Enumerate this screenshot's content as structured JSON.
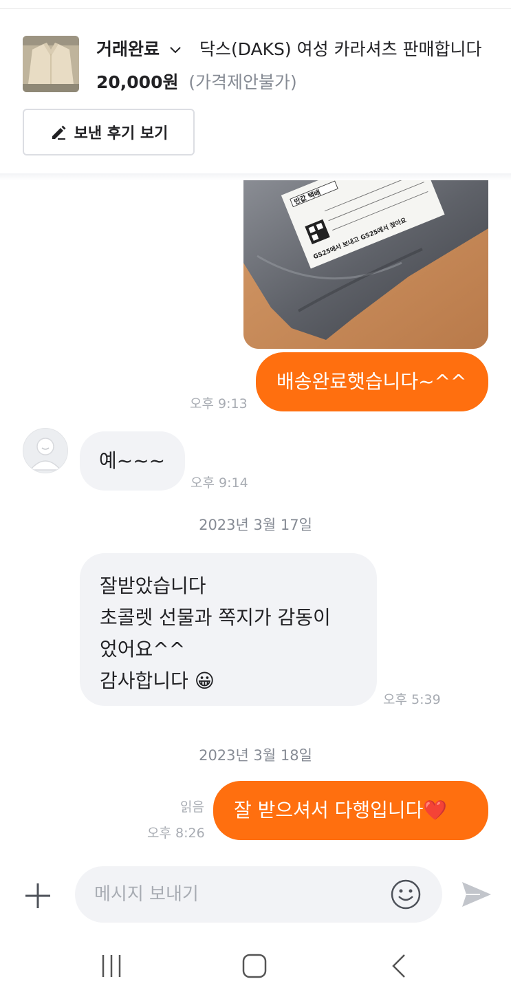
{
  "product": {
    "status": "거래완료",
    "title": "닥스(DAKS) 여성 카라셔츠 판매합니다",
    "price": "20,000원",
    "price_note": "(가격제안불가)"
  },
  "review_button": {
    "label": "보낸 후기 보기"
  },
  "messages": [
    {
      "from": "me",
      "text": "배송완료햇습니다~^^",
      "time": "오후 9:13"
    },
    {
      "from": "other",
      "text": "예~~~",
      "time": "오후 9:14"
    },
    {
      "date": "2023년 3월 17일"
    },
    {
      "from": "other",
      "lines": [
        "잘받았습니다",
        "초콜렛 선물과 쪽지가 감동이",
        "었어요^^",
        "감사합니다 😀"
      ],
      "time": "오후 5:39"
    },
    {
      "date": "2023년 3월 18일"
    },
    {
      "from": "me",
      "text": "잘 받으셔서 다행입니다❤️",
      "time": "오후 8:26",
      "read": "읽음"
    }
  ],
  "photo_label": {
    "line1": "반값 택배",
    "line2": "GS25에서 보내고 GS25에서 찾아요"
  },
  "input": {
    "placeholder": "메시지 보내기",
    "value": ""
  },
  "icons": [
    "pencil-icon",
    "chevron-down-icon",
    "plus-icon",
    "emoji-icon",
    "send-icon",
    "recents-icon",
    "home-icon",
    "back-icon"
  ],
  "colors": {
    "accent": "#ff6f0f",
    "bubble_other": "#f2f3f6",
    "muted": "#a8acb3"
  }
}
